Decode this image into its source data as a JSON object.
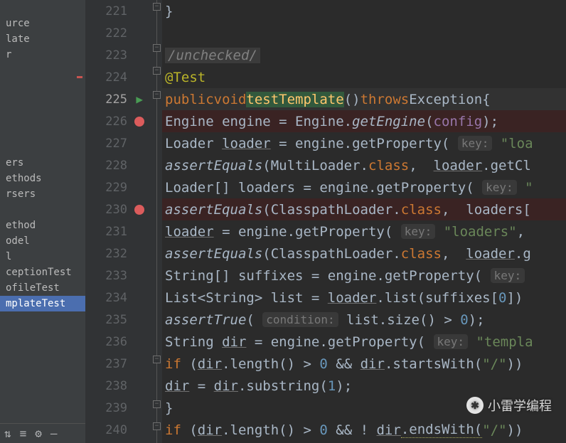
{
  "sidebar": {
    "items": [
      {
        "label": "urce"
      },
      {
        "label": "late"
      },
      {
        "label": "r"
      },
      {
        "label": "ers"
      },
      {
        "label": "ethods"
      },
      {
        "label": "rsers"
      },
      {
        "label": "ethod"
      },
      {
        "label": "odel"
      },
      {
        "label": "l"
      },
      {
        "label": "ceptionTest"
      },
      {
        "label": "ofileTest"
      },
      {
        "label": "mplateTest"
      }
    ]
  },
  "gutter": {
    "lines": [
      "221",
      "222",
      "223",
      "224",
      "225",
      "226",
      "227",
      "228",
      "229",
      "230",
      "231",
      "232",
      "233",
      "234",
      "235",
      "236",
      "237",
      "238",
      "239",
      "240"
    ],
    "current": "225",
    "breakpoints": [
      "226",
      "230"
    ],
    "run_icon_line": "225",
    "modified_line": "224"
  },
  "code": {
    "l221": {
      "brace": "}"
    },
    "l223": {
      "comment": "/unchecked/"
    },
    "l224": {
      "anno": "@Test"
    },
    "l225": {
      "kw1": "public",
      "kw2": "void",
      "name": "testTemplate",
      "parens": "()",
      "kw3": "throws",
      "exc": "Exception",
      "brace": "{"
    },
    "l226": {
      "t1": "Engine engine = Engine.",
      "call": "getEngine",
      "p_open": "(",
      "arg": "config",
      "p_close": ");"
    },
    "l227": {
      "t1": "Loader ",
      "var": "loader",
      "t2": " = engine.getProperty( ",
      "hint": "key:",
      "str": " \"loa"
    },
    "l228": {
      "call": "assertEquals",
      "t1": "(MultiLoader.",
      "kw": "class",
      "t2": ",  ",
      "var": "loader",
      "t3": ".getCl"
    },
    "l229": {
      "t1": "Loader[] loaders = engine.getProperty( ",
      "hint": "key:",
      "str": " \""
    },
    "l230": {
      "call": "assertEquals",
      "t1": "(ClasspathLoader.",
      "kw": "class",
      "t2": ",  loaders["
    },
    "l231": {
      "var": "loader",
      "t1": " = engine.getProperty( ",
      "hint": "key:",
      "str": " \"loaders\"",
      "t2": ","
    },
    "l232": {
      "call": "assertEquals",
      "t1": "(ClasspathLoader.",
      "kw": "class",
      "t2": ",  ",
      "var": "loader",
      "t3": ".g"
    },
    "l233": {
      "t1": "String[] suffixes = engine.getProperty( ",
      "hint": "key:"
    },
    "l234": {
      "t1": "List<String> list = ",
      "var": "loader",
      "t2": ".list(suffixes[",
      "num": "0",
      "t3": "])"
    },
    "l235": {
      "call": "assertTrue",
      "t1": "( ",
      "hint": "condition:",
      "t2": " list.size() > ",
      "num": "0",
      "t3": ");"
    },
    "l236": {
      "t1": "String ",
      "var": "dir",
      "t2": " = engine.getProperty( ",
      "hint": "key:",
      "str": " \"templa"
    },
    "l237": {
      "kw": "if",
      "t1": " (",
      "v1": "dir",
      "t2": ".length() > ",
      "n1": "0",
      "t3": " && ",
      "v2": "dir",
      "t4": ".startsWith(",
      "s1": "\"/\"",
      "t5": "))"
    },
    "l238": {
      "v1": "dir",
      "t1": " = ",
      "v2": "dir",
      "t2": ".substring(",
      "n1": "1",
      "t3": ");"
    },
    "l239": {
      "brace": "}"
    },
    "l240": {
      "kw": "if",
      "t1": " (",
      "v1": "dir",
      "t2": ".length() > ",
      "n1": "0",
      "t3": " && ! ",
      "v2": "dir",
      "t4": ".endsWith(",
      "s1": "\"/\"",
      "t5": "))"
    }
  },
  "watermark": {
    "text": "小雷学编程"
  }
}
